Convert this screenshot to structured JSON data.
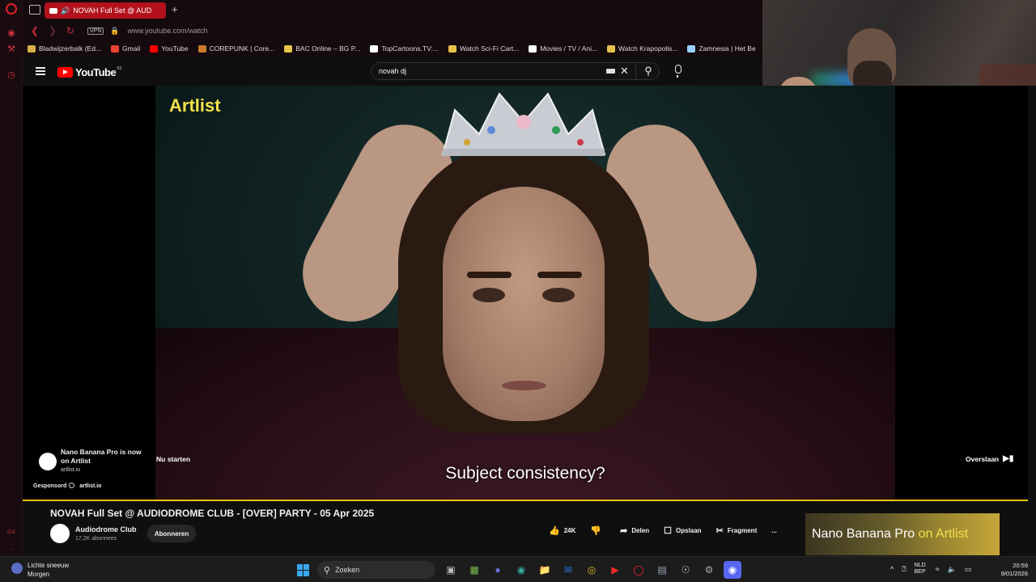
{
  "browser": {
    "tab_title": "NOVAH Full Set @ AUD",
    "address_url": "www.youtube.com/watch",
    "vpn_label": "VPN",
    "bookmarks": [
      {
        "label": "Bladwijzerbalk (Ed...",
        "color": "#d9b04a"
      },
      {
        "label": "Gmail",
        "color": "#ea4335"
      },
      {
        "label": "YouTube",
        "color": "#ff0000"
      },
      {
        "label": "COREPUNK | Core...",
        "color": "#cc7a2a"
      },
      {
        "label": "BAC Online – BG P...",
        "color": "#e6c24a"
      },
      {
        "label": "TopCartoons.TV:...",
        "color": "#ffffff"
      },
      {
        "label": "Watch Sci-Fi Cart...",
        "color": "#e6c24a"
      },
      {
        "label": "Movies / TV / Ani...",
        "color": "#ffffff"
      },
      {
        "label": "Watch Krapopolis...",
        "color": "#e6c24a"
      },
      {
        "label": "Zamnesia | Het Be",
        "color": "#9ad0ff"
      }
    ],
    "rail_bottom_labels": [
      "GX",
      "..."
    ]
  },
  "youtube": {
    "logo_text": "YouTube",
    "country_code": "BE",
    "search_value": "novah dj"
  },
  "ad": {
    "brand_overlay": "Artlist",
    "subtitle": "Subject consistency?",
    "headline": "Nano Banana Pro is now on Artlist",
    "domain": "artlist.io",
    "cta": "Nu starten",
    "sponsored_label": "Gesponsord",
    "sponsored_domain": "artlist.io",
    "skip_label": "Overslaan",
    "progress_color": "#f2c200"
  },
  "video": {
    "title": "NOVAH Full Set @ AUDIODROME CLUB - [OVER] PARTY - 05 Apr 2025",
    "channel": "Audiodrome Club",
    "subscribers": "17,2K abonnees",
    "subscribe_label": "Abonneren",
    "likes": "24K",
    "share_label": "Delen",
    "save_label": "Opslaan",
    "clip_label": "Fragment",
    "more_label": "...",
    "promo_text_a": "Nano Banana Pro",
    "promo_text_b": "on Artlist"
  },
  "taskbar": {
    "weather_title": "Lichte sneeuw",
    "weather_sub": "Morgen",
    "search_placeholder": "Zoeken",
    "lang_top": "NLD",
    "lang_bottom": "BEP",
    "time": "20:59",
    "date": "9/01/2026"
  }
}
